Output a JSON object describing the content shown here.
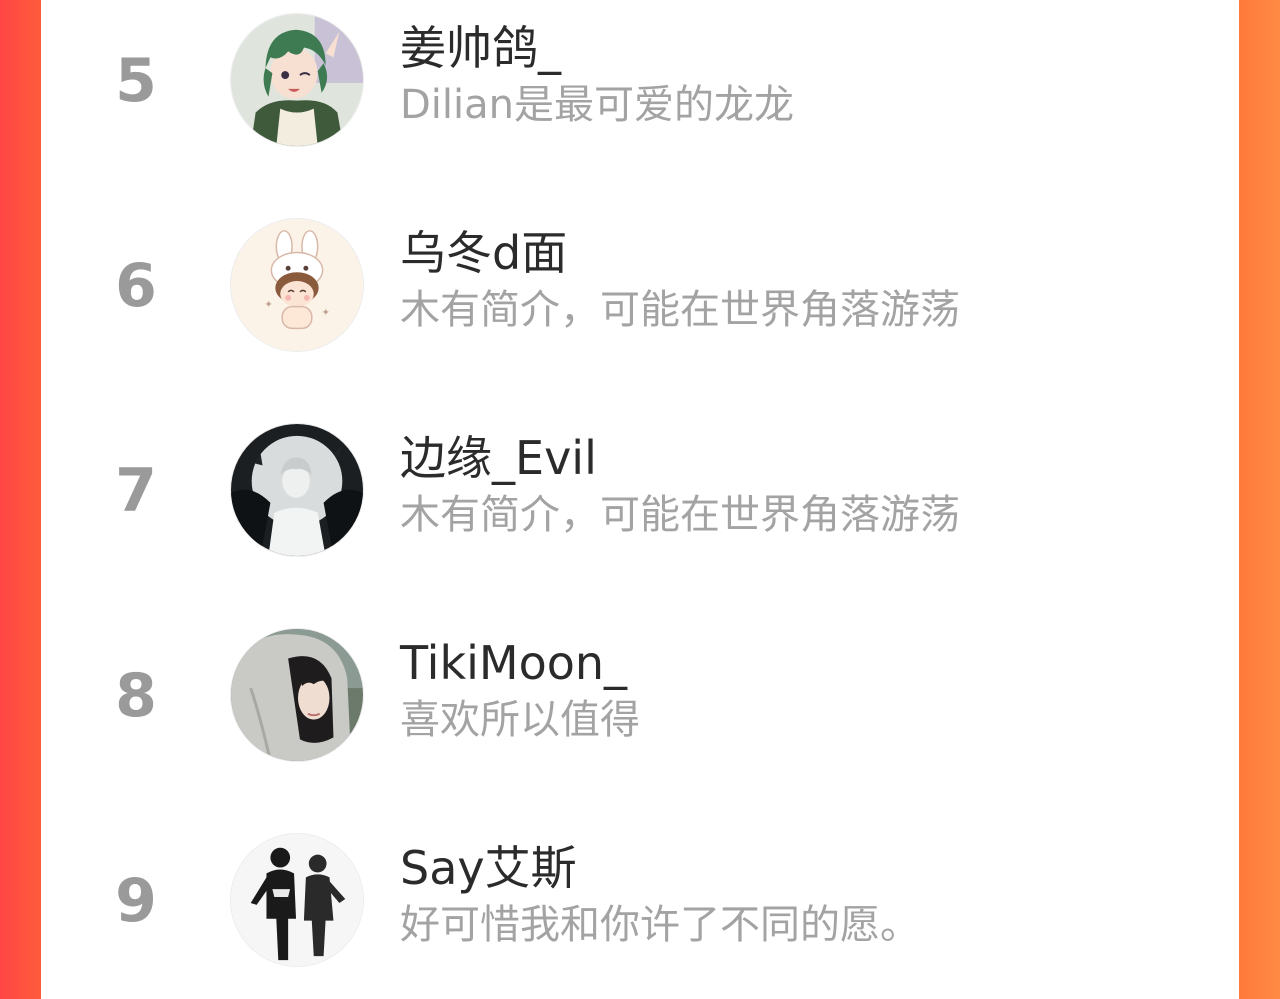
{
  "colors": {
    "background_left": "#ff4545",
    "background_right": "#ff8a44",
    "panel": "#ffffff",
    "rank_text": "#9a9a9a",
    "name_text": "#2b2b2b",
    "bio_text": "#a3a3a3"
  },
  "ranking": {
    "items": [
      {
        "rank": "5",
        "name": "姜帅鸽_",
        "bio": "Dilian是最可爱的龙龙",
        "avatar_icon": "anime-green-hair-avatar-icon"
      },
      {
        "rank": "6",
        "name": "乌冬d面",
        "bio": "木有简介，可能在世界角落游荡",
        "avatar_icon": "cartoon-bunny-hat-avatar-icon"
      },
      {
        "rank": "7",
        "name": "边缘_Evil",
        "bio": "木有简介，可能在世界角落游荡",
        "avatar_icon": "moon-winged-figure-avatar-icon"
      },
      {
        "rank": "8",
        "name": "TikiMoon_",
        "bio": "喜欢所以值得",
        "avatar_icon": "hooded-girl-avatar-icon"
      },
      {
        "rank": "9",
        "name": "Say艾斯",
        "bio": "好可惜我和你许了不同的愿。",
        "avatar_icon": "two-silhouettes-avatar-icon"
      }
    ]
  }
}
